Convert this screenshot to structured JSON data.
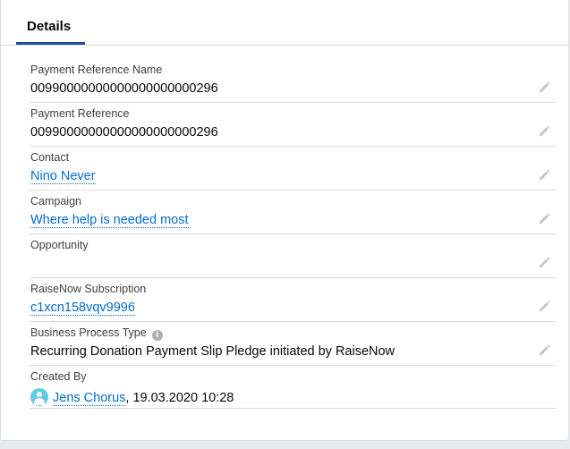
{
  "tabs": {
    "details": "Details"
  },
  "fields": {
    "payment_reference_name": {
      "label": "Payment Reference Name",
      "value": "00990000000000000000000296"
    },
    "payment_reference": {
      "label": "Payment Reference",
      "value": "00990000000000000000000296"
    },
    "contact": {
      "label": "Contact",
      "value": "Nino Never"
    },
    "campaign": {
      "label": "Campaign",
      "value": "Where help is needed most"
    },
    "opportunity": {
      "label": "Opportunity",
      "value": ""
    },
    "raisenow_subscription": {
      "label": "RaiseNow Subscription",
      "value": "c1xcn158vqv9996"
    },
    "business_process_type": {
      "label": "Business Process Type",
      "value": "Recurring Donation Payment Slip Pledge initiated by RaiseNow",
      "info_icon": "i"
    },
    "created_by": {
      "label": "Created By",
      "user": "Jens Chorus",
      "date": ", 19.03.2020 10:28"
    }
  },
  "icons": {
    "edit": "pencil-icon",
    "info": "info-icon",
    "avatar": "user-avatar-icon"
  },
  "colors": {
    "link": "#006dcc",
    "tab_underline": "#1b5297",
    "avatar": "#65cae4"
  }
}
